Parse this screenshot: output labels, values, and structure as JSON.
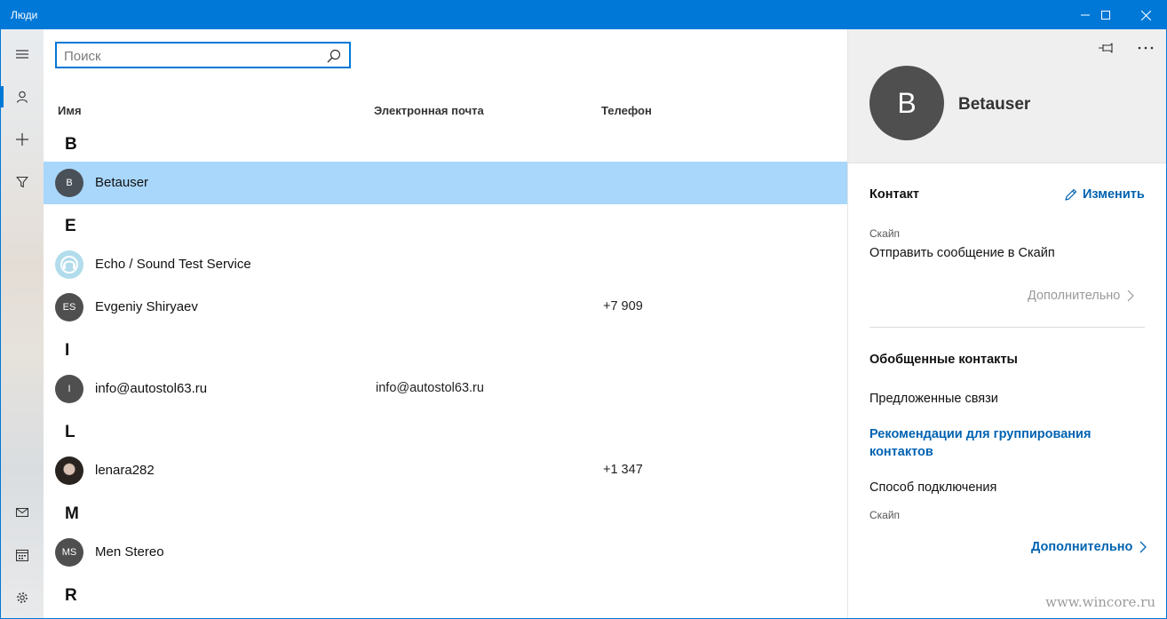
{
  "window": {
    "title": "Люди",
    "accent_color": "#0078d7"
  },
  "titlebar_buttons": [
    {
      "name": "minimize-icon"
    },
    {
      "name": "maximize-icon"
    },
    {
      "name": "close-icon"
    }
  ],
  "rail": {
    "items": [
      {
        "icon": "hamburger-menu-icon"
      },
      {
        "icon": "person-icon",
        "active": true
      },
      {
        "icon": "plus-icon"
      },
      {
        "icon": "filter-icon"
      },
      {
        "icon": "mail-icon"
      },
      {
        "icon": "calendar-icon"
      },
      {
        "icon": "gear-icon"
      }
    ]
  },
  "search": {
    "placeholder": "Поиск",
    "value": "",
    "icon": "search-icon"
  },
  "columns": {
    "name": "Имя",
    "email": "Электронная почта",
    "phone": "Телефон"
  },
  "groups": [
    {
      "letter": "B"
    },
    {
      "letter": "E"
    },
    {
      "letter": "I"
    },
    {
      "letter": "L"
    },
    {
      "letter": "M"
    },
    {
      "letter": "R"
    }
  ],
  "contacts": [
    {
      "initials": "B",
      "name": "Betauser",
      "email": "",
      "phone": "",
      "selected": true
    },
    {
      "initials": "",
      "name": "Echo / Sound Test Service",
      "email": "",
      "phone": "",
      "avatar": "echo-bot-icon"
    },
    {
      "initials": "ES",
      "name": "Evgeniy Shiryaev",
      "email": "",
      "phone": "+7 909"
    },
    {
      "initials": "I",
      "name": "info@autostol63.ru",
      "email": "info@autostol63.ru",
      "phone": ""
    },
    {
      "initials": "",
      "name": "lenara282",
      "email": "",
      "phone": "+1 347",
      "avatar": "photo"
    },
    {
      "initials": "MS",
      "name": "Men Stereo",
      "email": "",
      "phone": ""
    }
  ],
  "detail": {
    "initials": "B",
    "name": "Betauser",
    "pin_icon": "pin-icon",
    "more_icon": "more-options-icon",
    "contact_title": "Контакт",
    "edit_label": "Изменить",
    "skype_label": "Скайп",
    "skype_action": "Отправить сообщение в Скайп",
    "more_label_1": "Дополнительно",
    "linked_title": "Обобщенные контакты",
    "suggested_links": "Предложенные связи",
    "recommendations_link": "Рекомендации для группирования контактов",
    "connection_method": "Способ подключения",
    "connection_value": "Скайп",
    "more_label_2": "Дополнительно"
  },
  "watermark": "www.wincore.ru"
}
